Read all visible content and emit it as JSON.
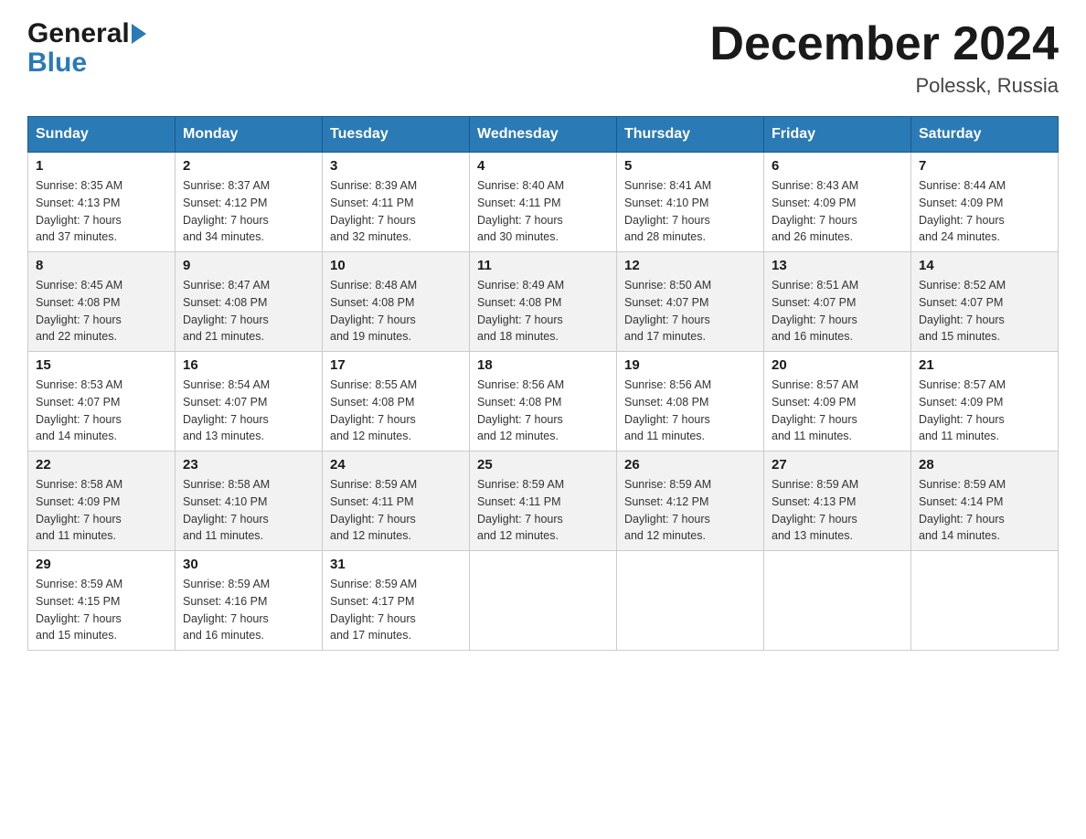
{
  "header": {
    "logo_general": "General",
    "logo_blue": "Blue",
    "month_title": "December 2024",
    "location": "Polessk, Russia"
  },
  "weekdays": [
    "Sunday",
    "Monday",
    "Tuesday",
    "Wednesday",
    "Thursday",
    "Friday",
    "Saturday"
  ],
  "weeks": [
    [
      {
        "day": "1",
        "sunrise": "8:35 AM",
        "sunset": "4:13 PM",
        "daylight": "7 hours and 37 minutes."
      },
      {
        "day": "2",
        "sunrise": "8:37 AM",
        "sunset": "4:12 PM",
        "daylight": "7 hours and 34 minutes."
      },
      {
        "day": "3",
        "sunrise": "8:39 AM",
        "sunset": "4:11 PM",
        "daylight": "7 hours and 32 minutes."
      },
      {
        "day": "4",
        "sunrise": "8:40 AM",
        "sunset": "4:11 PM",
        "daylight": "7 hours and 30 minutes."
      },
      {
        "day": "5",
        "sunrise": "8:41 AM",
        "sunset": "4:10 PM",
        "daylight": "7 hours and 28 minutes."
      },
      {
        "day": "6",
        "sunrise": "8:43 AM",
        "sunset": "4:09 PM",
        "daylight": "7 hours and 26 minutes."
      },
      {
        "day": "7",
        "sunrise": "8:44 AM",
        "sunset": "4:09 PM",
        "daylight": "7 hours and 24 minutes."
      }
    ],
    [
      {
        "day": "8",
        "sunrise": "8:45 AM",
        "sunset": "4:08 PM",
        "daylight": "7 hours and 22 minutes."
      },
      {
        "day": "9",
        "sunrise": "8:47 AM",
        "sunset": "4:08 PM",
        "daylight": "7 hours and 21 minutes."
      },
      {
        "day": "10",
        "sunrise": "8:48 AM",
        "sunset": "4:08 PM",
        "daylight": "7 hours and 19 minutes."
      },
      {
        "day": "11",
        "sunrise": "8:49 AM",
        "sunset": "4:08 PM",
        "daylight": "7 hours and 18 minutes."
      },
      {
        "day": "12",
        "sunrise": "8:50 AM",
        "sunset": "4:07 PM",
        "daylight": "7 hours and 17 minutes."
      },
      {
        "day": "13",
        "sunrise": "8:51 AM",
        "sunset": "4:07 PM",
        "daylight": "7 hours and 16 minutes."
      },
      {
        "day": "14",
        "sunrise": "8:52 AM",
        "sunset": "4:07 PM",
        "daylight": "7 hours and 15 minutes."
      }
    ],
    [
      {
        "day": "15",
        "sunrise": "8:53 AM",
        "sunset": "4:07 PM",
        "daylight": "7 hours and 14 minutes."
      },
      {
        "day": "16",
        "sunrise": "8:54 AM",
        "sunset": "4:07 PM",
        "daylight": "7 hours and 13 minutes."
      },
      {
        "day": "17",
        "sunrise": "8:55 AM",
        "sunset": "4:08 PM",
        "daylight": "7 hours and 12 minutes."
      },
      {
        "day": "18",
        "sunrise": "8:56 AM",
        "sunset": "4:08 PM",
        "daylight": "7 hours and 12 minutes."
      },
      {
        "day": "19",
        "sunrise": "8:56 AM",
        "sunset": "4:08 PM",
        "daylight": "7 hours and 11 minutes."
      },
      {
        "day": "20",
        "sunrise": "8:57 AM",
        "sunset": "4:09 PM",
        "daylight": "7 hours and 11 minutes."
      },
      {
        "day": "21",
        "sunrise": "8:57 AM",
        "sunset": "4:09 PM",
        "daylight": "7 hours and 11 minutes."
      }
    ],
    [
      {
        "day": "22",
        "sunrise": "8:58 AM",
        "sunset": "4:09 PM",
        "daylight": "7 hours and 11 minutes."
      },
      {
        "day": "23",
        "sunrise": "8:58 AM",
        "sunset": "4:10 PM",
        "daylight": "7 hours and 11 minutes."
      },
      {
        "day": "24",
        "sunrise": "8:59 AM",
        "sunset": "4:11 PM",
        "daylight": "7 hours and 12 minutes."
      },
      {
        "day": "25",
        "sunrise": "8:59 AM",
        "sunset": "4:11 PM",
        "daylight": "7 hours and 12 minutes."
      },
      {
        "day": "26",
        "sunrise": "8:59 AM",
        "sunset": "4:12 PM",
        "daylight": "7 hours and 12 minutes."
      },
      {
        "day": "27",
        "sunrise": "8:59 AM",
        "sunset": "4:13 PM",
        "daylight": "7 hours and 13 minutes."
      },
      {
        "day": "28",
        "sunrise": "8:59 AM",
        "sunset": "4:14 PM",
        "daylight": "7 hours and 14 minutes."
      }
    ],
    [
      {
        "day": "29",
        "sunrise": "8:59 AM",
        "sunset": "4:15 PM",
        "daylight": "7 hours and 15 minutes."
      },
      {
        "day": "30",
        "sunrise": "8:59 AM",
        "sunset": "4:16 PM",
        "daylight": "7 hours and 16 minutes."
      },
      {
        "day": "31",
        "sunrise": "8:59 AM",
        "sunset": "4:17 PM",
        "daylight": "7 hours and 17 minutes."
      },
      null,
      null,
      null,
      null
    ]
  ]
}
